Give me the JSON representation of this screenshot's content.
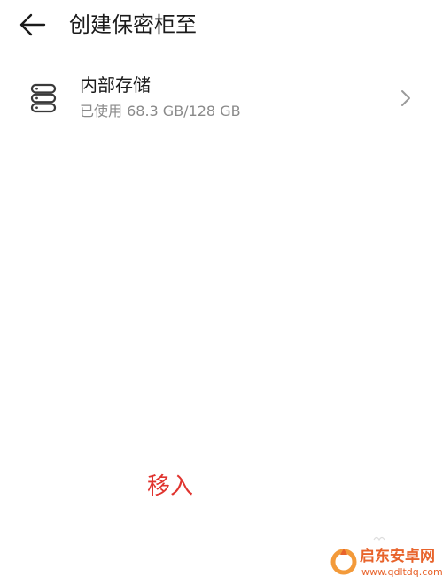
{
  "header": {
    "title": "创建保密柜至",
    "back_icon": "arrow-left-icon"
  },
  "storage": {
    "icon": "storage-stack-icon",
    "title": "内部存储",
    "usage": "已使用 68.3 GB/128 GB",
    "chevron_icon": "chevron-right-icon"
  },
  "annotation": {
    "label": "移入",
    "color": "#e0342f"
  },
  "watermark": {
    "name": "启东安卓网",
    "url": "www.qdltdq.com",
    "color": "#e8632b"
  }
}
